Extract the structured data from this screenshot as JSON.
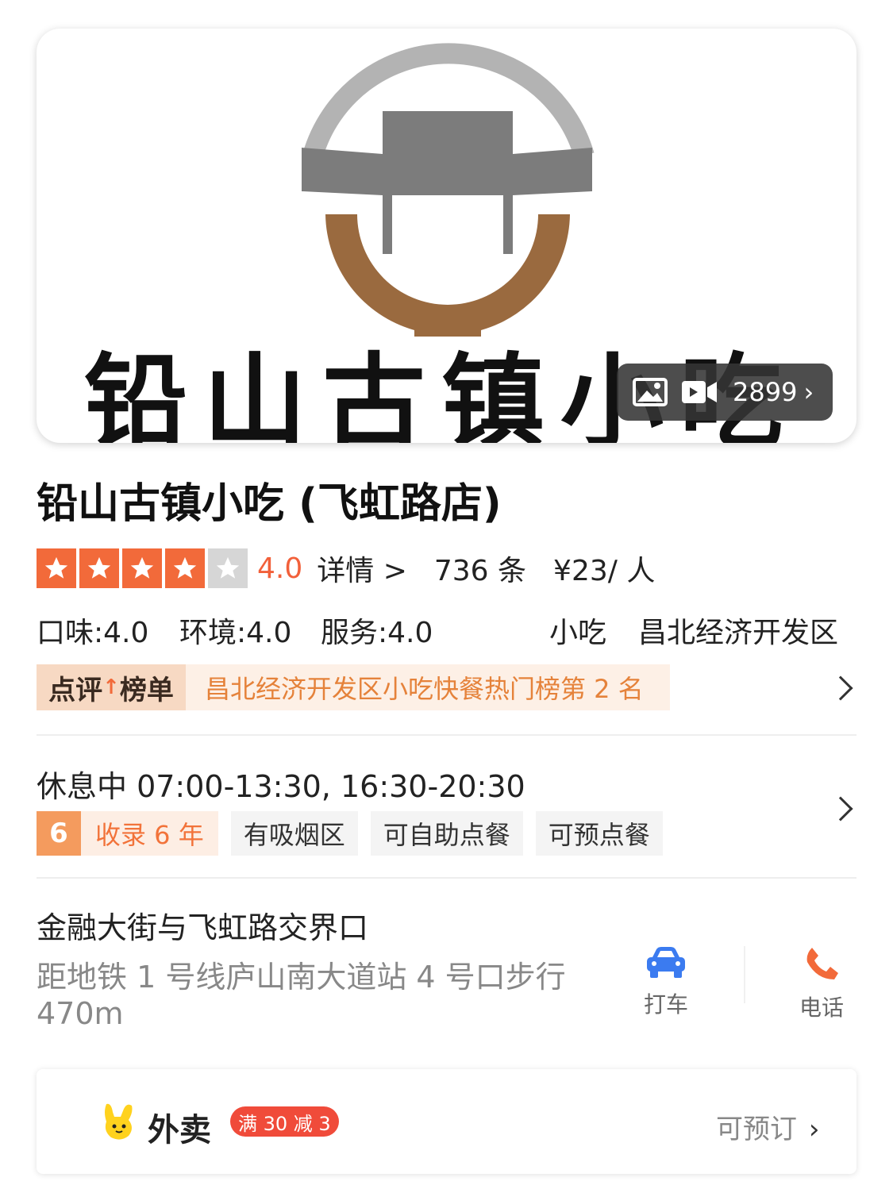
{
  "hero": {
    "logo_text": "铅山古镇小吃",
    "media_count": "2899",
    "icons": [
      "photo-icon",
      "video-icon",
      "chevron-right-icon"
    ]
  },
  "shop": {
    "name": "铅山古镇小吃 (飞虹路店)",
    "rating": 4.0,
    "rating_text": "4.0",
    "details_label": "详情 >",
    "review_count": "736 条",
    "price": "¥23/ 人",
    "taste": "口味:4.0",
    "environment": "环境:4.0",
    "service": "服务:4.0",
    "category": "小吃",
    "district": "昌北经济开发区"
  },
  "ranking": {
    "tag_prefix": "点评",
    "tag_suffix": "榜单",
    "text": "昌北经济开发区小吃快餐热门榜第 2 名"
  },
  "hours": {
    "text": "休息中 07:00-13:30, 16:30-20:30",
    "years_num": "6",
    "years_text": "收录 6 年",
    "tags": [
      "有吸烟区",
      "可自助点餐",
      "可预点餐"
    ]
  },
  "location": {
    "address": "金融大街与飞虹路交界口",
    "metro": "距地铁 1 号线庐山南大道站 4 号口步行 470m"
  },
  "actions": {
    "taxi_label": "打车",
    "phone_label": "电话",
    "taxi_color": "#3b7bf0",
    "phone_color": "#f26a3a"
  },
  "takeout": {
    "label": "外卖",
    "promo": "满 30 减 3",
    "reserve": "可预订"
  },
  "colors": {
    "accent": "#f26a3a",
    "rank_text": "#e5823a"
  }
}
